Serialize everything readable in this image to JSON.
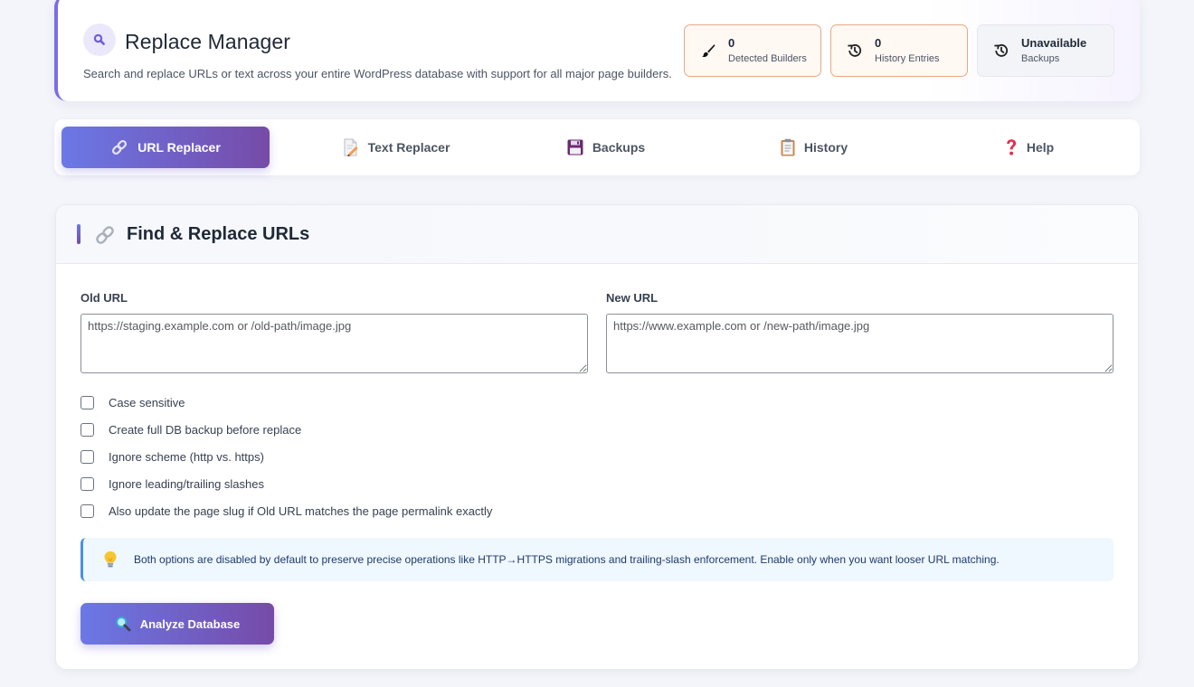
{
  "header": {
    "title": "Replace Manager",
    "subtitle": "Search and replace URLs or text across your entire WordPress database with support for all major page builders.",
    "stats": [
      {
        "value": "0",
        "label": "Detected Builders",
        "icon": "paintbrush-icon"
      },
      {
        "value": "0",
        "label": "History Entries",
        "icon": "history-icon"
      },
      {
        "value": "Unavailable",
        "label": "Backups",
        "icon": "history-icon"
      }
    ]
  },
  "tabs": [
    {
      "label": "URL Replacer",
      "icon": "link-icon",
      "active": true
    },
    {
      "label": "Text Replacer",
      "icon": "memo-icon",
      "active": false
    },
    {
      "label": "Backups",
      "icon": "floppy-disk-icon",
      "active": false
    },
    {
      "label": "History",
      "icon": "clipboard-icon",
      "active": false
    },
    {
      "label": "Help",
      "icon": "question-mark-icon",
      "active": false
    }
  ],
  "section": {
    "title": "Find & Replace URLs",
    "icon": "link-icon"
  },
  "form": {
    "old_url_label": "Old URL",
    "old_url_placeholder": "https://staging.example.com or /old-path/image.jpg",
    "old_url_value": "",
    "new_url_label": "New URL",
    "new_url_placeholder": "https://www.example.com or /new-path/image.jpg",
    "new_url_value": ""
  },
  "options": [
    {
      "label": "Case sensitive",
      "checked": false
    },
    {
      "label": "Create full DB backup before replace",
      "checked": false
    },
    {
      "label": "Ignore scheme (http vs. https)",
      "checked": false
    },
    {
      "label": "Ignore leading/trailing slashes",
      "checked": false
    },
    {
      "label": "Also update the page slug if Old URL matches the page permalink exactly",
      "checked": false
    }
  ],
  "info": {
    "text": "Both options are disabled by default to preserve precise operations like HTTP→HTTPS migrations and trailing-slash enforcement. Enable only when you want looser URL matching.",
    "icon": "lightbulb-icon"
  },
  "actions": {
    "analyze_label": "Analyze Database",
    "analyze_icon": "magnifier-icon"
  },
  "colors": {
    "accent_start": "#6b78e6",
    "accent_end": "#764ba8",
    "stat_border": "#e7a888",
    "info_border": "#4a90e2",
    "info_bg": "#eff7ff"
  }
}
